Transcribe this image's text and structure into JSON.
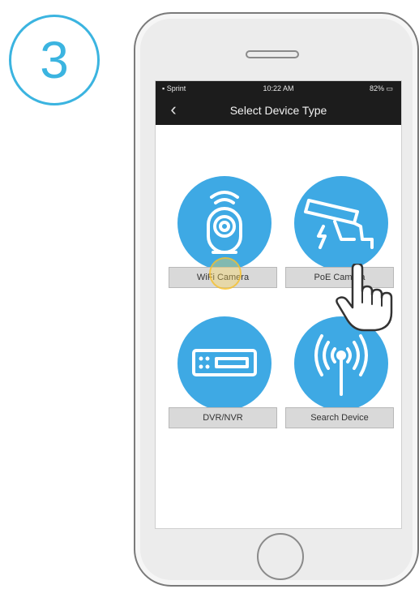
{
  "step": {
    "number": "3"
  },
  "status_bar": {
    "carrier": "Sprint",
    "time": "10:22 AM",
    "battery": "82%"
  },
  "nav": {
    "title": "Select Device Type",
    "back_icon": "chevron-left-icon"
  },
  "tiles": [
    {
      "label": "WiFi Camera",
      "icon": "wifi-camera-icon"
    },
    {
      "label": "PoE Camera",
      "icon": "poe-camera-icon"
    },
    {
      "label": "DVR/NVR",
      "icon": "dvr-nvr-icon"
    },
    {
      "label": "Search Device",
      "icon": "antenna-signal-icon"
    }
  ],
  "colors": {
    "accent": "#3bb4e0",
    "tile_blue": "#3ea9e4",
    "bar": "#1c1c1c"
  }
}
